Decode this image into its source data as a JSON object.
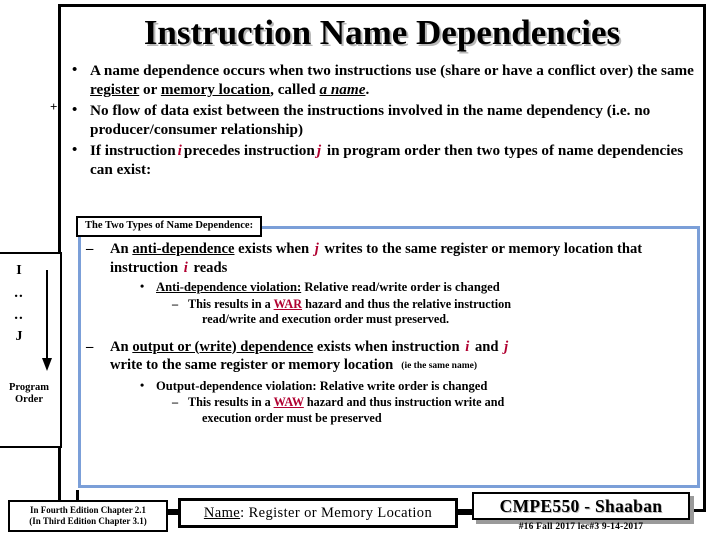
{
  "slide": {
    "title": "Instruction Name Dependencies",
    "plus_mark": "+"
  },
  "top_bullets": [
    {
      "marker": "•",
      "part1": "A name dependence occurs when two instructions use (share or have a conflict over) the same ",
      "under1": "register",
      "mid1": " or ",
      "under2": "memory location",
      "mid2": ", called ",
      "emph": "a name",
      "tail": "."
    },
    {
      "marker": "•",
      "text": "No flow of data exist between the instructions involved in the name dependency (i.e. no producer/consumer relationship)"
    },
    {
      "marker": "•",
      "pre": "If instruction",
      "i": "i",
      "mid": "precedes instruction",
      "j": "j",
      "post": "in program order then two types of name dependencies can exist:"
    }
  ],
  "program_order": {
    "first": "I",
    "dots1": "..",
    "dots2": "..",
    "last": "J",
    "label_line1": "Program",
    "label_line2": "Order",
    "arrow_icon": "down-arrow-icon"
  },
  "types_label": "The Two Types of Name Dependence:",
  "anti_dependence": {
    "dash": "–",
    "pre": "An ",
    "term": "anti-dependence",
    "mid1": " exists when ",
    "j": "j",
    "mid2": " writes to the same register or memory location that instruction ",
    "i": "i",
    "tail": " reads",
    "violation": {
      "bullet": "•",
      "term": "Anti-dependence violation:",
      "text": "  Relative read/write order is changed"
    },
    "result": {
      "dash": "–",
      "pre": "This results in a ",
      "hazard": "WAR",
      "post": " hazard and thus the relative instruction",
      "cont": "read/write and execution order must preserved."
    }
  },
  "output_dependence": {
    "dash": "–",
    "pre": "An ",
    "term": "output or (write) dependence",
    "mid1": " exists when instruction ",
    "i": "i",
    "mid2": " and ",
    "j": "j",
    "line2": "write to the same register or memory location",
    "note": "(ie the same name)",
    "violation": {
      "bullet": "•",
      "term": "Output-dependence violation:",
      "text": "  Relative write order is changed"
    },
    "result": {
      "dash": "–",
      "pre": "This results  in a ",
      "hazard": "WAW",
      "post": " hazard and thus instruction write and",
      "cont": "execution order must be preserved"
    }
  },
  "footer": {
    "edition_line1": "In Fourth Edition Chapter 2.1",
    "edition_line2": "(In Third Edition Chapter 3.1)",
    "name_label": "Name",
    "name_value": ": Register  or  Memory Location",
    "course": "CMPE550 - Shaaban",
    "meta": "#16  Fall 2017   lec#3  9-14-2017"
  },
  "colors": {
    "accent_red": "#b00030",
    "blue_border": "#7b9fd8",
    "frame_black": "#000000"
  }
}
